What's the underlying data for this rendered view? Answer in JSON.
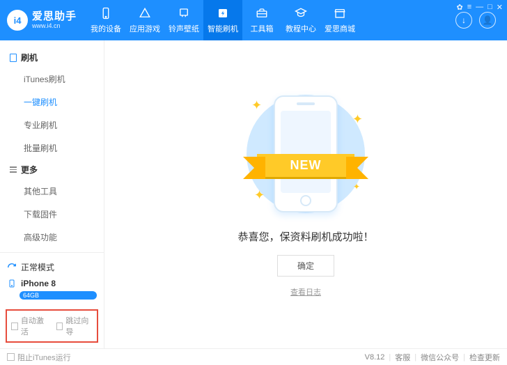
{
  "brand": {
    "logo_text": "i4",
    "title": "爱思助手",
    "subtitle": "www.i4.cn"
  },
  "window_controls": {
    "skin": "✿",
    "menu": "≡",
    "min": "—",
    "max": "□",
    "close": "✕"
  },
  "nav": [
    {
      "label": "我的设备",
      "icon": "phone"
    },
    {
      "label": "应用游戏",
      "icon": "apps"
    },
    {
      "label": "铃声壁纸",
      "icon": "ringtone"
    },
    {
      "label": "智能刷机",
      "icon": "flash"
    },
    {
      "label": "工具箱",
      "icon": "toolbox"
    },
    {
      "label": "教程中心",
      "icon": "tutorial"
    },
    {
      "label": "爱思商城",
      "icon": "store"
    }
  ],
  "nav_active_index": 3,
  "right_buttons": {
    "download": "↓",
    "user": "👤"
  },
  "sidebar": {
    "group1": {
      "title": "刷机",
      "items": [
        "iTunes刷机",
        "一键刷机",
        "专业刷机",
        "批量刷机"
      ],
      "active_index": 1
    },
    "group2": {
      "title": "更多",
      "items": [
        "其他工具",
        "下载固件",
        "高级功能"
      ]
    }
  },
  "mode": {
    "label": "正常模式"
  },
  "device": {
    "name": "iPhone 8",
    "storage": "64GB"
  },
  "bottom_checks": {
    "auto_activate": "自动激活",
    "skip_guide": "跳过向导"
  },
  "main": {
    "ribbon": "NEW",
    "success_text": "恭喜您，保资料刷机成功啦！",
    "ok": "确定",
    "view_log": "查看日志"
  },
  "status": {
    "block_itunes": "阻止iTunes运行",
    "version": "V8.12",
    "svc": "客服",
    "wechat": "微信公众号",
    "update": "检查更新"
  }
}
